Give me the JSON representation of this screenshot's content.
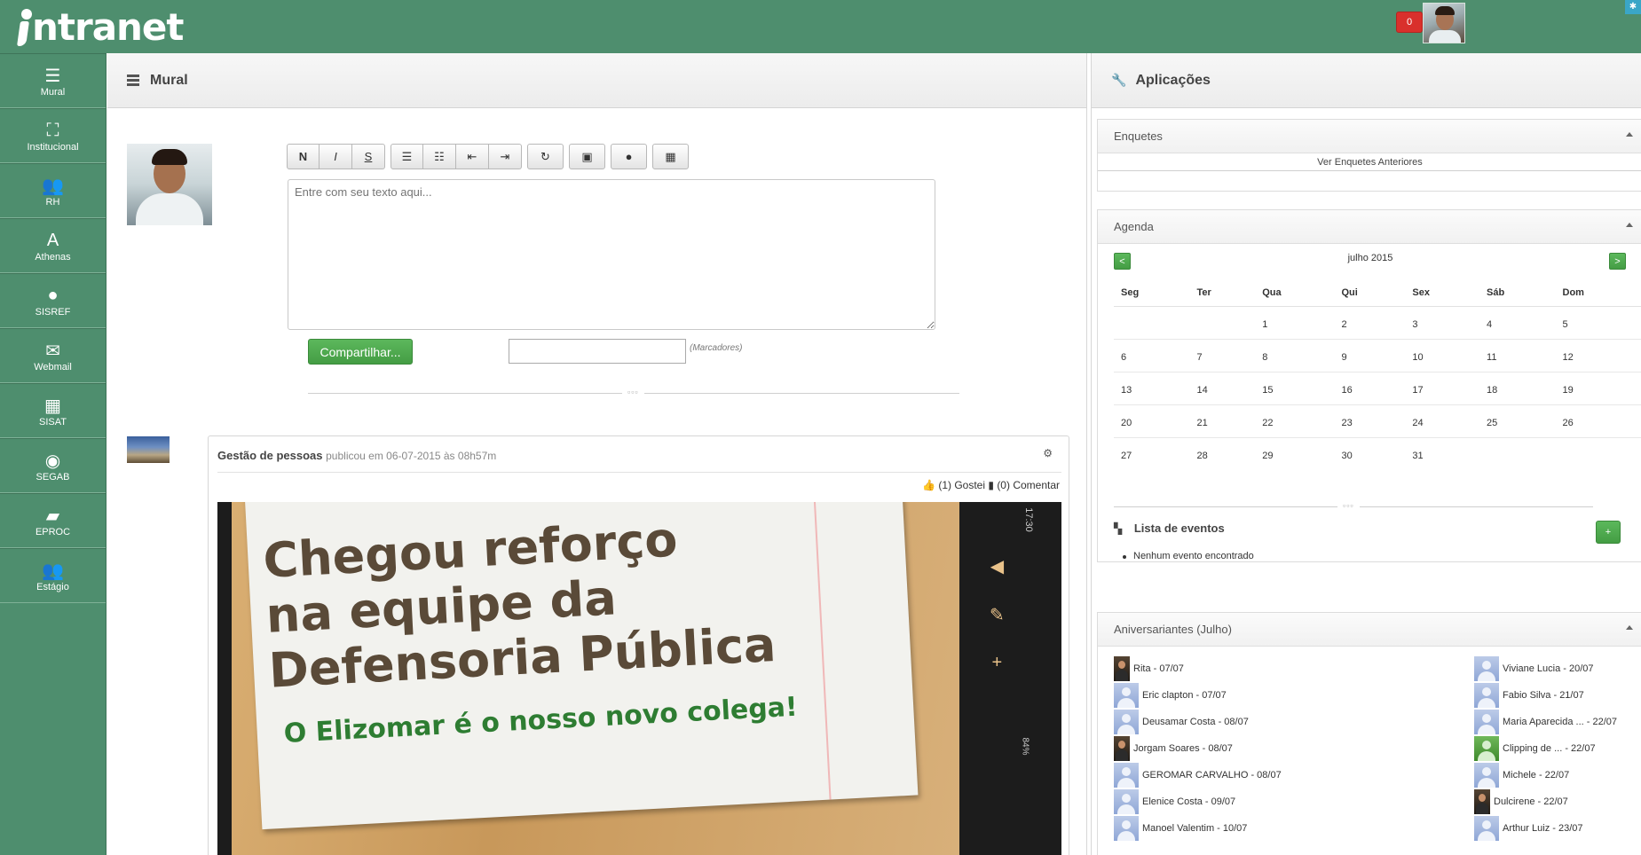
{
  "topbar": {
    "logo_text": "ntranet",
    "notification_count": "0",
    "corner_icon": "gear-icon"
  },
  "sidebar": {
    "items": [
      {
        "label": "Mural",
        "icon": "list-icon",
        "glyph": "☰"
      },
      {
        "label": "Institucional",
        "icon": "sitemap-icon",
        "glyph": "⛶"
      },
      {
        "label": "RH",
        "icon": "group-icon",
        "glyph": "👥"
      },
      {
        "label": "Athenas",
        "icon": "font-icon",
        "glyph": "A"
      },
      {
        "label": "SISREF",
        "icon": "user-icon",
        "glyph": "●"
      },
      {
        "label": "Webmail",
        "icon": "envelope-icon",
        "glyph": "✉"
      },
      {
        "label": "SISAT",
        "icon": "calendar-icon",
        "glyph": "▦"
      },
      {
        "label": "SEGAB",
        "icon": "eye-icon",
        "glyph": "◉"
      },
      {
        "label": "EPROC",
        "icon": "book-icon",
        "glyph": "▰"
      },
      {
        "label": "Estágio",
        "icon": "group-icon",
        "glyph": "👥"
      }
    ]
  },
  "main": {
    "title": "Mural",
    "toolbar": {
      "bold": "N",
      "italic": "I",
      "strike": "S"
    },
    "editor_placeholder": "Entre com seu texto aqui...",
    "share_label": "Compartilhar...",
    "tags_label": "(Marcadores)",
    "divider_dots": "▫▫▫"
  },
  "post": {
    "author": "Gestão de pessoas",
    "meta": "publicou em 06-07-2015 às 08h57m",
    "likes": "(1) Gostei",
    "comments": "(0) Comentar",
    "image_line1": "Chegou reforço",
    "image_line2": "na equipe da",
    "image_line3": "Defensoria Pública",
    "image_line4": "O Elizomar é o nosso novo colega!",
    "image_time": "17:30",
    "image_battery": "84%"
  },
  "right": {
    "title": "Aplicações",
    "enquetes": {
      "title": "Enquetes",
      "link": "Ver Enquetes Anteriores"
    },
    "agenda": {
      "title": "Agenda",
      "prev": "<",
      "next": ">",
      "month": "julho 2015",
      "weekdays": [
        "Seg",
        "Ter",
        "Qua",
        "Qui",
        "Sex",
        "Sáb",
        "Dom"
      ],
      "weeks": [
        [
          "",
          "",
          "1",
          "2",
          "3",
          "4",
          "5"
        ],
        [
          "6",
          "7",
          "8",
          "9",
          "10",
          "11",
          "12"
        ],
        [
          "13",
          "14",
          "15",
          "16",
          "17",
          "18",
          "19"
        ],
        [
          "20",
          "21",
          "22",
          "23",
          "24",
          "25",
          "26"
        ],
        [
          "27",
          "28",
          "29",
          "30",
          "31",
          "",
          ""
        ]
      ],
      "divider_dots": "▫▫▫",
      "eventos_title": "Lista de eventos",
      "add_label": "+",
      "no_events": "Nenhum evento encontrado"
    },
    "aniversariantes": {
      "title": "Aniversariantes (Julho)",
      "left": [
        {
          "text": "Rita - 07/07",
          "pic": "photo"
        },
        {
          "text": "Eric clapton - 07/07",
          "pic": "default"
        },
        {
          "text": "Deusamar Costa - 08/07",
          "pic": "default"
        },
        {
          "text": "Jorgam Soares - 08/07",
          "pic": "photo"
        },
        {
          "text": "GEROMAR CARVALHO - 08/07",
          "pic": "default"
        },
        {
          "text": "Elenice Costa - 09/07",
          "pic": "default"
        },
        {
          "text": "Manoel Valentim - 10/07",
          "pic": "default"
        }
      ],
      "right": [
        {
          "text": "Viviane Lucia - 20/07",
          "pic": "default"
        },
        {
          "text": "Fabio Silva - 21/07",
          "pic": "default"
        },
        {
          "text": "Maria Aparecida ... - 22/07",
          "pic": "default"
        },
        {
          "text": "Clipping de ... - 22/07",
          "pic": "green"
        },
        {
          "text": "Michele - 22/07",
          "pic": "default"
        },
        {
          "text": "Dulcirene - 22/07",
          "pic": "photo"
        },
        {
          "text": "Arthur Luiz - 23/07",
          "pic": "default"
        }
      ]
    }
  }
}
